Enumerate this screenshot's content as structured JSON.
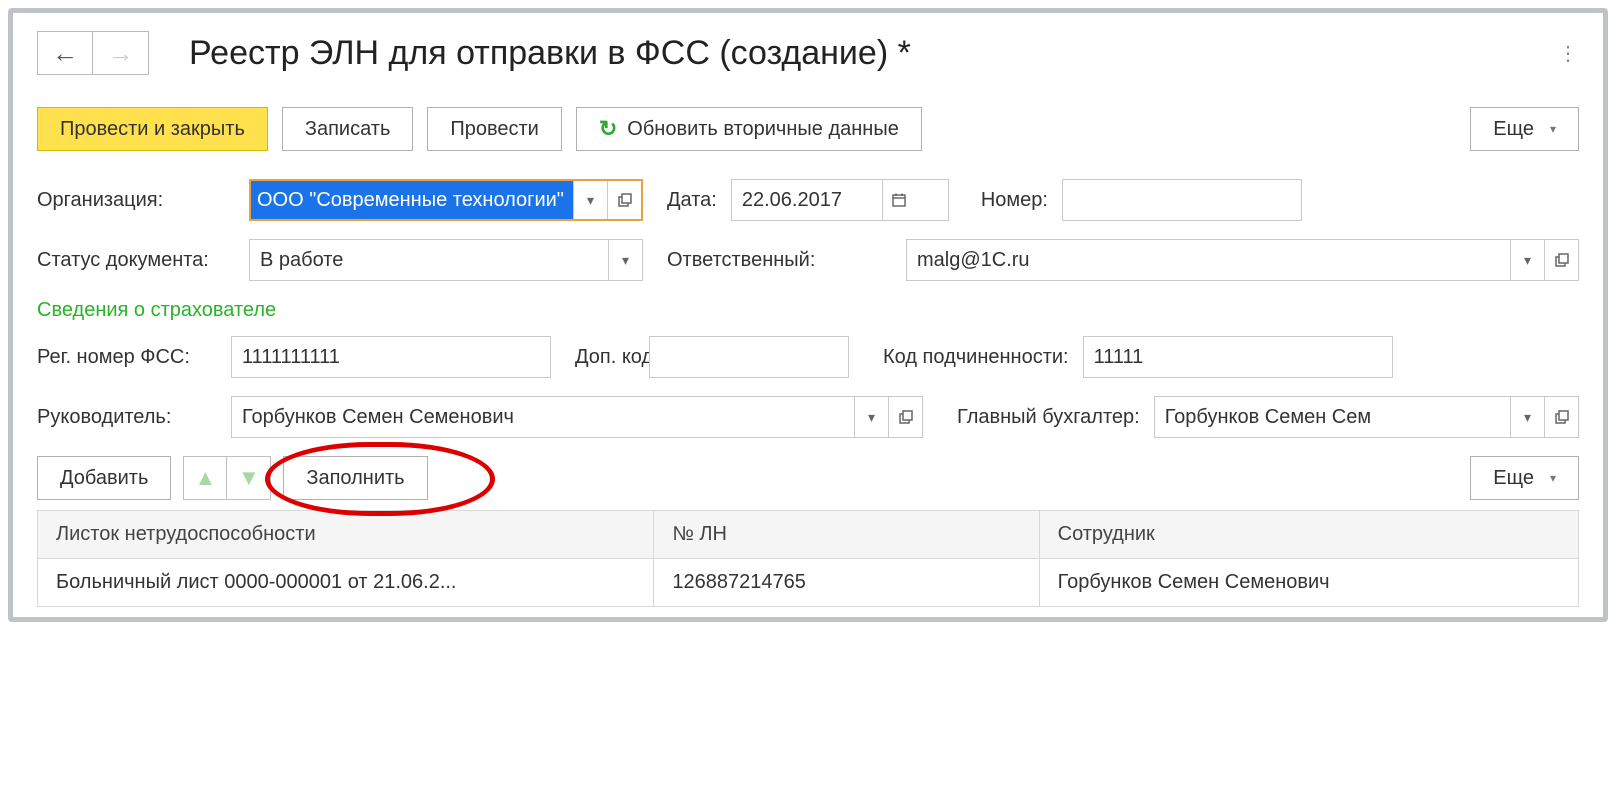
{
  "header": {
    "title": "Реестр ЭЛН для отправки в ФСС (создание) *"
  },
  "toolbar": {
    "post_and_close": "Провести и закрыть",
    "save": "Записать",
    "post": "Провести",
    "refresh_secondary": "Обновить вторичные данные",
    "more": "Еще"
  },
  "fields": {
    "org_label": "Организация:",
    "org_value": "ООО \"Современные технологии\"",
    "date_label": "Дата:",
    "date_value": "22.06.2017",
    "number_label": "Номер:",
    "number_value": "",
    "status_label": "Статус документа:",
    "status_value": "В работе",
    "responsible_label": "Ответственный:",
    "responsible_value": "malg@1C.ru",
    "section_insurer": "Сведения о страхователе",
    "fss_reg_label": "Рег. номер ФСС:",
    "fss_reg_value": "1111111111",
    "dop_kod_label": "Доп. код:",
    "dop_kod_value": "",
    "subord_code_label": "Код подчиненности:",
    "subord_code_value": "11111",
    "head_label": "Руководитель:",
    "head_value": "Горбунков Семен Семенович",
    "chief_acc_label": "Главный бухгалтер:",
    "chief_acc_value": "Горбунков Семен Сем"
  },
  "table_toolbar": {
    "add": "Добавить",
    "fill": "Заполнить",
    "more": "Еще"
  },
  "table": {
    "columns": [
      "Листок нетрудоспособности",
      "№ ЛН",
      "Сотрудник"
    ],
    "rows": [
      {
        "sheet": "Больничный лист 0000-000001 от 21.06.2...",
        "ln_no": "126887214765",
        "employee": "Горбунков Семен Семенович"
      }
    ]
  }
}
